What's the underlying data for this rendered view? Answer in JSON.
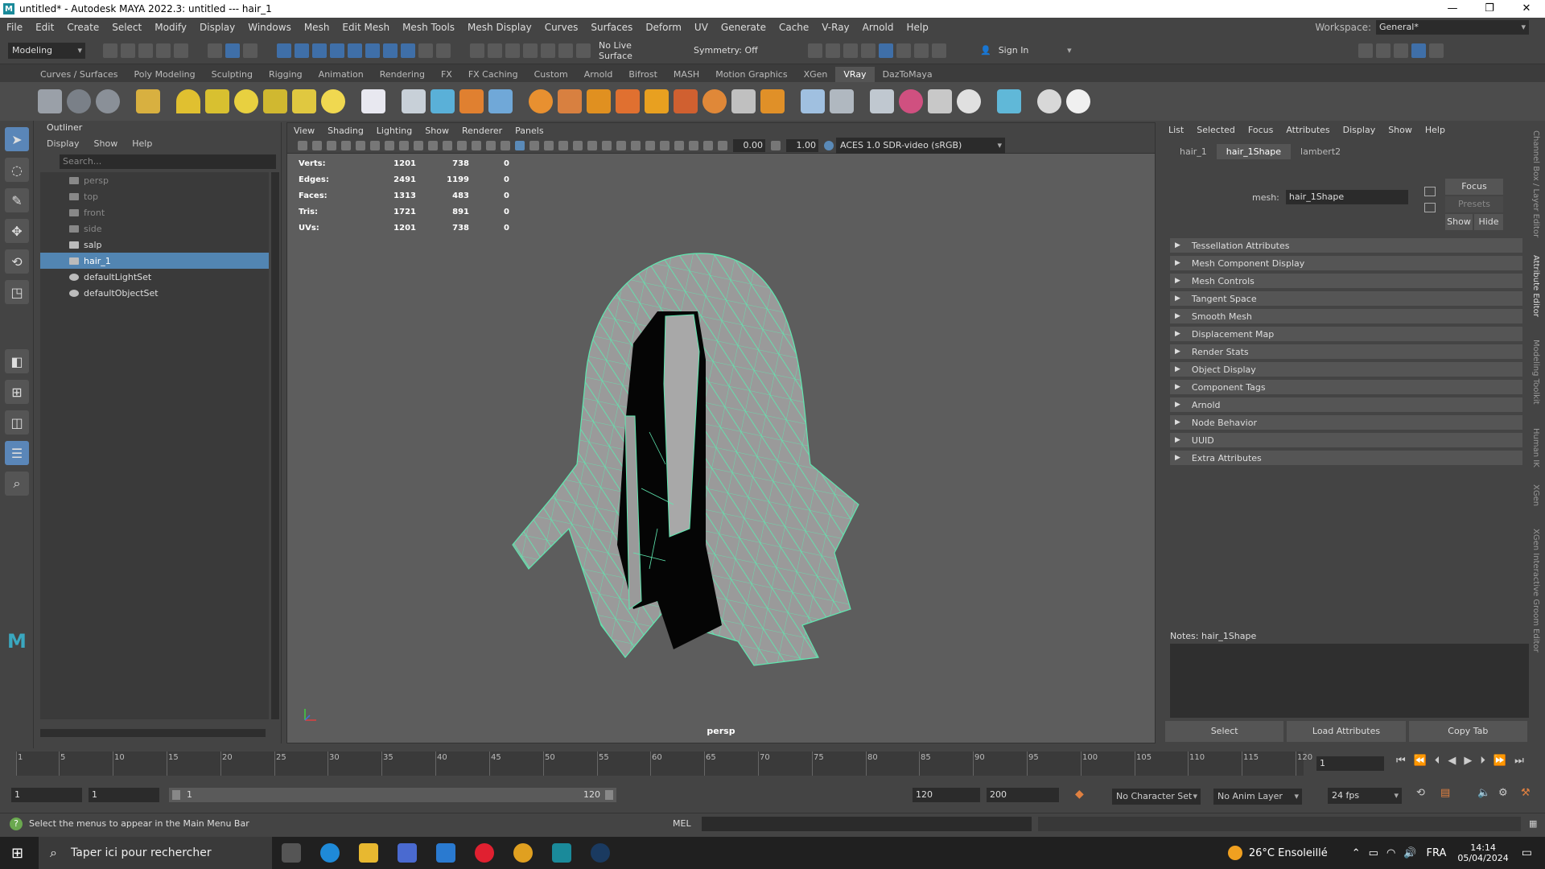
{
  "titlebar": {
    "title": "untitled* - Autodesk MAYA 2022.3: untitled  ---  hair_1"
  },
  "menubar": {
    "items": [
      "File",
      "Edit",
      "Create",
      "Select",
      "Modify",
      "Display",
      "Windows",
      "Mesh",
      "Edit Mesh",
      "Mesh Tools",
      "Mesh Display",
      "Curves",
      "Surfaces",
      "Deform",
      "UV",
      "Generate",
      "Cache",
      "V-Ray",
      "Arnold",
      "Help"
    ],
    "workspace_label": "Workspace:",
    "workspace_value": "General*"
  },
  "statusline": {
    "mode": "Modeling",
    "live_surface": "No Live Surface",
    "symmetry": "Symmetry: Off",
    "sign_in": "Sign In"
  },
  "shelf": {
    "tabs": [
      "Curves / Surfaces",
      "Poly Modeling",
      "Sculpting",
      "Rigging",
      "Animation",
      "Rendering",
      "FX",
      "FX Caching",
      "Custom",
      "Arnold",
      "Bifrost",
      "MASH",
      "Motion Graphics",
      "XGen",
      "VRay",
      "DazToMaya"
    ],
    "active_tab": "VRay"
  },
  "outliner": {
    "title": "Outliner",
    "menu": [
      "Display",
      "Show",
      "Help"
    ],
    "search_placeholder": "Search...",
    "items": [
      {
        "label": "persp",
        "dim": true
      },
      {
        "label": "top",
        "dim": true
      },
      {
        "label": "front",
        "dim": true
      },
      {
        "label": "side",
        "dim": true
      },
      {
        "label": "salp",
        "dim": false
      },
      {
        "label": "hair_1",
        "dim": false,
        "selected": true
      },
      {
        "label": "defaultLightSet",
        "dim": false
      },
      {
        "label": "defaultObjectSet",
        "dim": false
      }
    ]
  },
  "viewport": {
    "menu": [
      "View",
      "Shading",
      "Lighting",
      "Show",
      "Renderer",
      "Panels"
    ],
    "field1": "0.00",
    "field2": "1.00",
    "colorspace": "ACES 1.0 SDR-video (sRGB)",
    "camera": "persp",
    "hud": [
      {
        "label": "Verts:",
        "a": "1201",
        "b": "738",
        "c": "0"
      },
      {
        "label": "Edges:",
        "a": "2491",
        "b": "1199",
        "c": "0"
      },
      {
        "label": "Faces:",
        "a": "1313",
        "b": "483",
        "c": "0"
      },
      {
        "label": "Tris:",
        "a": "1721",
        "b": "891",
        "c": "0"
      },
      {
        "label": "UVs:",
        "a": "1201",
        "b": "738",
        "c": "0"
      }
    ]
  },
  "attr": {
    "menu": [
      "List",
      "Selected",
      "Focus",
      "Attributes",
      "Display",
      "Show",
      "Help"
    ],
    "tabs": [
      "hair_1",
      "hair_1Shape",
      "lambert2"
    ],
    "active_tab": "hair_1Shape",
    "mesh_label": "mesh:",
    "mesh_value": "hair_1Shape",
    "focus": "Focus",
    "presets": "Presets",
    "show": "Show",
    "hide": "Hide",
    "sections": [
      "Tessellation Attributes",
      "Mesh Component Display",
      "Mesh Controls",
      "Tangent Space",
      "Smooth Mesh",
      "Displacement Map",
      "Render Stats",
      "Object Display",
      "Component Tags",
      "Arnold",
      "Node Behavior",
      "UUID",
      "Extra Attributes"
    ],
    "notes": "Notes:  hair_1Shape",
    "buttons": [
      "Select",
      "Load Attributes",
      "Copy Tab"
    ]
  },
  "sidetabs": [
    "Channel Box / Layer Editor",
    "Attribute Editor",
    "Modeling Toolkit",
    "Human IK",
    "XGen",
    "XGen Interactive Groom Editor"
  ],
  "timeline": {
    "ticks": [
      "1",
      "5",
      "10",
      "15",
      "20",
      "25",
      "30",
      "35",
      "40",
      "45",
      "50",
      "55",
      "60",
      "65",
      "70",
      "75",
      "80",
      "85",
      "90",
      "95",
      "100",
      "105",
      "110",
      "115",
      "120"
    ],
    "current_frame": "1"
  },
  "range": {
    "start": "1",
    "start2": "1",
    "slider_start": "1",
    "slider_end": "120",
    "end": "120",
    "end2": "200",
    "character_set": "No Character Set",
    "anim_layer": "No Anim Layer",
    "fps": "24 fps"
  },
  "commandline": {
    "help": "Select the menus to appear in the Main Menu Bar",
    "lang": "MEL"
  },
  "taskbar": {
    "search": "Taper ici pour rechercher",
    "weather": "26°C  Ensoleillé",
    "lang": "FRA",
    "time": "14:14",
    "date": "05/04/2024"
  }
}
